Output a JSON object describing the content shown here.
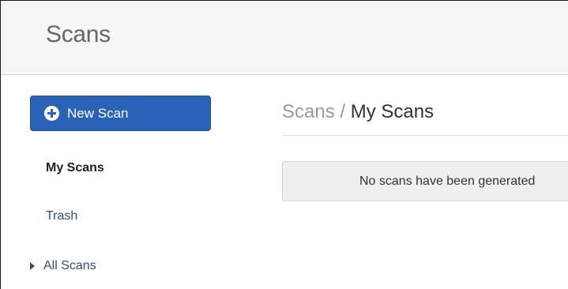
{
  "header": {
    "title": "Scans"
  },
  "sidebar": {
    "new_scan_label": "New Scan",
    "items": [
      {
        "label": "My Scans",
        "active": true
      },
      {
        "label": "Trash",
        "active": false
      },
      {
        "label": "All Scans",
        "active": false,
        "collapsed": true
      }
    ]
  },
  "main": {
    "breadcrumb": {
      "parent": "Scans",
      "separator": " / ",
      "current": "My Scans"
    },
    "empty_message": "No scans have been generated"
  },
  "colors": {
    "primary_button": "#2a62b8",
    "link": "#2f4f6f",
    "topbar_bg": "#f6f6f6",
    "empty_box_bg": "#efefef"
  },
  "icons": {
    "new_scan": "plus-circle-icon",
    "all_scans": "caret-right-icon"
  }
}
